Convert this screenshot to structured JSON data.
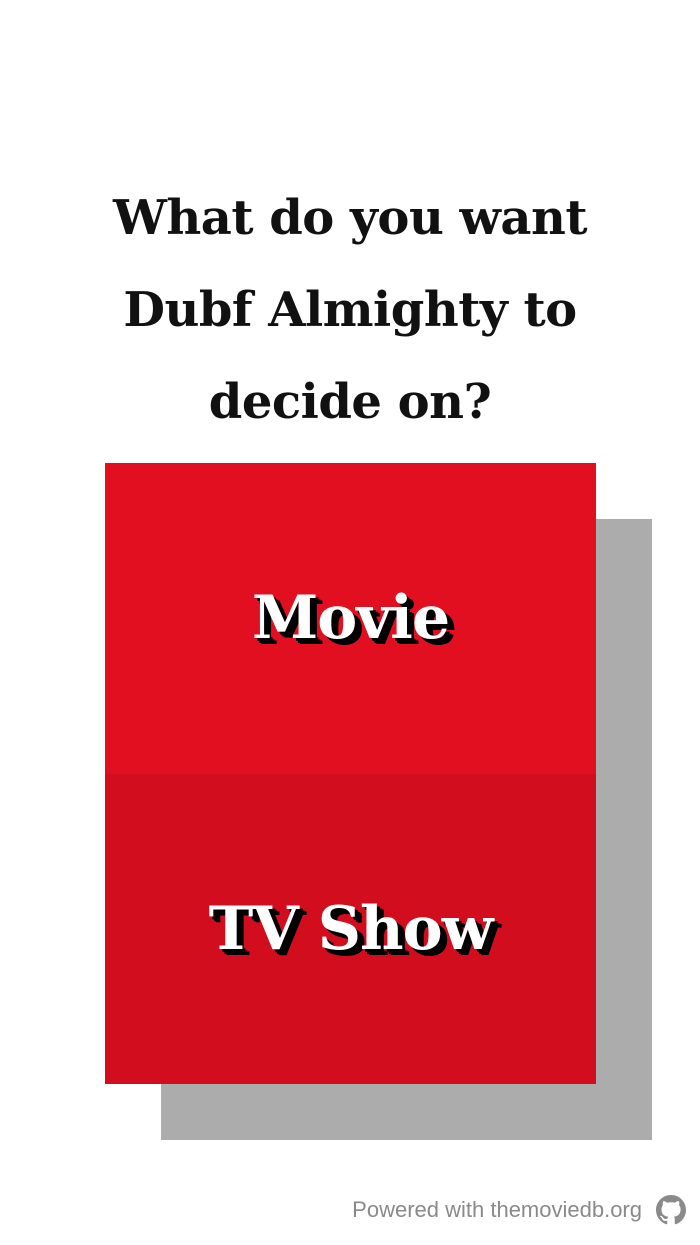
{
  "question": {
    "text": "What do you want Dubf Almighty to decide on?"
  },
  "choices": [
    {
      "label": "Movie"
    },
    {
      "label": "TV Show"
    }
  ],
  "footer": {
    "text": "Powered with themoviedb.org",
    "icon": "github-icon"
  },
  "colors": {
    "movie_background": "#e20f20",
    "tv_background": "#d20d1e",
    "shadow": "#acacac",
    "footer_text": "#8a8a8a"
  }
}
